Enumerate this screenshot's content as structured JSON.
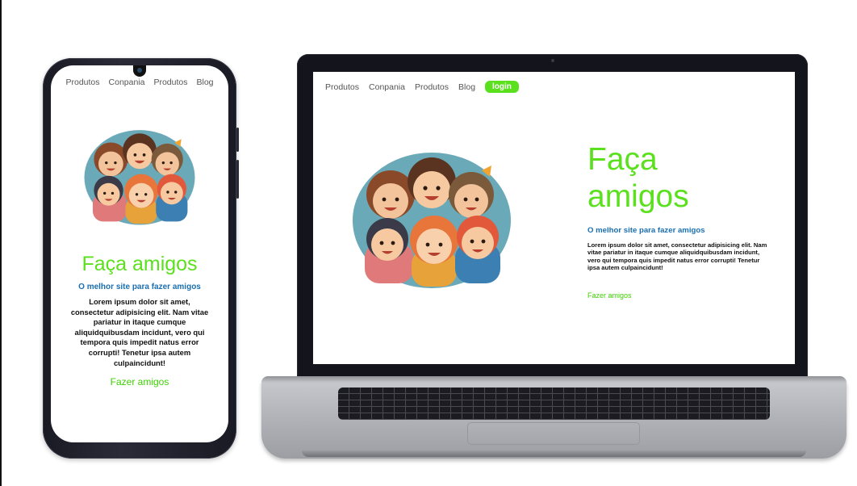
{
  "phone_page": {
    "nav": [
      "Produtos",
      "Conpania",
      "Produtos",
      "Blog"
    ],
    "title": "Faça amigos",
    "subtitle": "O melhor site para fazer amigos",
    "body": "Lorem ipsum dolor sit amet, consectetur adipisicing elit. Nam vitae pariatur in itaque cumque aliquidquibusdam incidunt, vero qui tempora quis impedit natus error corrupti! Tenetur ipsa autem culpaincidunt!",
    "cta": "Fazer amigos"
  },
  "laptop_page": {
    "nav": [
      "Produtos",
      "Conpania",
      "Produtos",
      "Blog"
    ],
    "login_label": "login",
    "title": "Faça amigos",
    "subtitle": "O melhor site para fazer amigos",
    "body": "Lorem ipsum dolor sit amet, consectetur adipisicing elit. Nam vitae pariatur in itaque cumque aliquidquibusdam incidunt, vero qui tempora quis impedit natus error corrupti! Tenetur ipsa autem culpaincidunt!",
    "cta": "Fazer amigos"
  },
  "colors": {
    "accent_green": "#5be01e",
    "link_green": "#3ed000",
    "subtitle_blue": "#1a6fb0",
    "nav_gray": "#555555"
  },
  "hero_image": "cartoon-friends-group-illustration"
}
